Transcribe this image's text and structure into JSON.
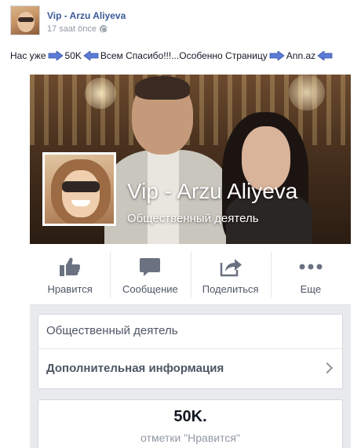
{
  "post": {
    "author": "Vip - Arzu Aliyeva",
    "time": "17 saat önce",
    "text": {
      "part1": "Нас уже",
      "part2": "50K",
      "part3": "Всем Спасибо!!!...Особенно Страницу",
      "part4": "Ann.az"
    }
  },
  "page": {
    "name": "Vip - Arzu Aliyeva",
    "category": "Общественный деятель"
  },
  "actions": [
    {
      "label": "Нравится",
      "icon": "thumbs-up-icon"
    },
    {
      "label": "Сообщение",
      "icon": "message-icon"
    },
    {
      "label": "Поделиться",
      "icon": "share-icon"
    },
    {
      "label": "Еще",
      "icon": "more-icon"
    }
  ],
  "info": {
    "category": "Общественный деятель",
    "more_info": "Дополнительная информация"
  },
  "likes": {
    "count": "50K.",
    "label": "отметки \"Нравится\""
  },
  "colors": {
    "author_link": "#3b5998",
    "arrow": "#5b7bd5",
    "icon_gray": "#6a7180"
  }
}
